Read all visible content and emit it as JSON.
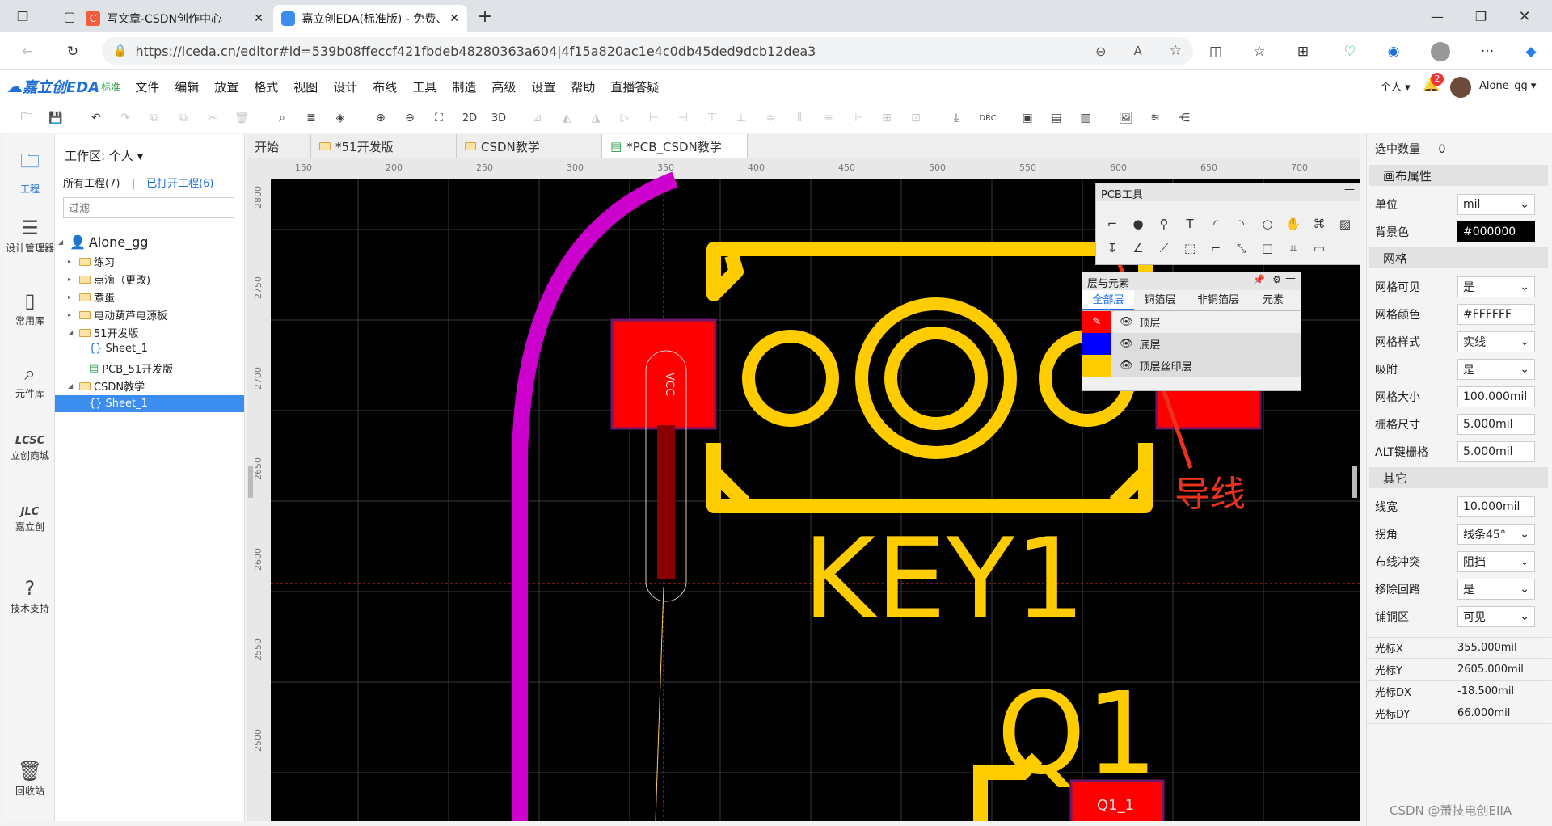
{
  "browser": {
    "tabs": [
      {
        "title": "写文章-CSDN创作中心",
        "icon": "csdn-icon"
      },
      {
        "title": "嘉立创EDA(标准版) - 免费、易用",
        "icon": "lceda-icon"
      }
    ],
    "url": "https://lceda.cn/editor#id=539b08ffeccf421fbdeb48280363a604|4f15a820ac1e4c0db45ded9dcb12dea3"
  },
  "app": {
    "logo_text": "嘉立创EDA",
    "logo_badge": "标准",
    "menu": [
      "文件",
      "编辑",
      "放置",
      "格式",
      "视图",
      "设计",
      "布线",
      "工具",
      "制造",
      "高级",
      "设置",
      "帮助",
      "直播答疑"
    ],
    "user_scope": "个人",
    "notification_count": "2",
    "username": "Alone_gg",
    "toolbar_text": {
      "2d": "2D",
      "3d": "3D",
      "drc": "DRC"
    }
  },
  "leftbar": [
    {
      "label": "工程",
      "icon": "project-icon"
    },
    {
      "label": "设计管理器",
      "icon": "design-manager-icon"
    },
    {
      "label": "常用库",
      "icon": "library-icon"
    },
    {
      "label": "元件库",
      "icon": "component-search-icon"
    },
    {
      "label": "立创商城",
      "icon": "lcsc-icon"
    },
    {
      "label": "嘉立创",
      "icon": "jlc-icon"
    },
    {
      "label": "技术支持",
      "icon": "support-icon"
    },
    {
      "label": "回收站",
      "icon": "trash-icon"
    }
  ],
  "project": {
    "workspace_label": "工作区: 个人",
    "all_projects": "所有工程(7)",
    "separator": "|",
    "opened_projects": "已打开工程(6)",
    "filter_placeholder": "过滤",
    "user": "Alone_gg",
    "items": [
      {
        "label": "练习"
      },
      {
        "label": "点滴（更改)"
      },
      {
        "label": "煮蛋"
      },
      {
        "label": "电动葫芦电源板"
      },
      {
        "label": "51开发版"
      },
      {
        "label": "Sheet_1"
      },
      {
        "label": "PCB_51开发版"
      },
      {
        "label": "CSDN教学"
      },
      {
        "label": "Sheet_1"
      }
    ]
  },
  "doc_tabs": [
    "开始",
    "*51开发版",
    "CSDN教学",
    "*PCB_CSDN教学"
  ],
  "ruler": {
    "top": [
      "150",
      "200",
      "250",
      "300",
      "350",
      "400",
      "450",
      "500",
      "550",
      "600",
      "650",
      "700"
    ],
    "left": [
      "2800",
      "2750",
      "2700",
      "2650",
      "2600",
      "2550",
      "2500"
    ]
  },
  "canvas": {
    "pad_label": "VCC",
    "key_label": "KEY1",
    "q_label": "Q1",
    "q_pad_label": "Q1_1",
    "annotation": "导线"
  },
  "pcb_tools": {
    "title": "PCB工具"
  },
  "layers_panel": {
    "title": "层与元素",
    "tabs": [
      "全部层",
      "铜箔层",
      "非铜箔层",
      "元素"
    ],
    "rows": [
      {
        "name": "顶层",
        "color": "#FF0000"
      },
      {
        "name": "底层",
        "color": "#0000FF"
      },
      {
        "name": "顶层丝印层",
        "color": "#FFCC00"
      }
    ]
  },
  "properties": {
    "selected_label": "选中数量",
    "selected_value": "0",
    "canvas_section": "画布属性",
    "unit_label": "单位",
    "unit_value": "mil",
    "bg_label": "背景色",
    "bg_value": "#000000",
    "grid_section": "网格",
    "grid_visible_label": "网格可见",
    "grid_visible_value": "是",
    "grid_color_label": "网格颜色",
    "grid_color_value": "#FFFFFF",
    "grid_style_label": "网格样式",
    "grid_style_value": "实线",
    "snap_label": "吸附",
    "snap_value": "是",
    "grid_size_label": "网格大小",
    "grid_size_value": "100.000mil",
    "grid_step_label": "栅格尺寸",
    "grid_step_value": "5.000mil",
    "alt_grid_label": "ALT键栅格",
    "alt_grid_value": "5.000mil",
    "other_section": "其它",
    "line_width_label": "线宽",
    "line_width_value": "10.000mil",
    "corner_label": "拐角",
    "corner_value": "线条45°",
    "conflict_label": "布线冲突",
    "conflict_value": "阻挡",
    "remove_loop_label": "移除回路",
    "remove_loop_value": "是",
    "copper_label": "铺铜区",
    "copper_value": "可见",
    "cursor": [
      {
        "k": "光标X",
        "v": "355.000mil"
      },
      {
        "k": "光标Y",
        "v": "2605.000mil"
      },
      {
        "k": "光标DX",
        "v": "-18.500mil"
      },
      {
        "k": "光标DY",
        "v": "66.000mil"
      }
    ]
  },
  "watermark": "CSDN @萧技电创EIIA",
  "colors": {
    "silk": "#FFCC00",
    "pad": "#FF0000",
    "track": "#CC00CC",
    "accent": "#1e6fd9",
    "selected": "#3b8df0"
  }
}
